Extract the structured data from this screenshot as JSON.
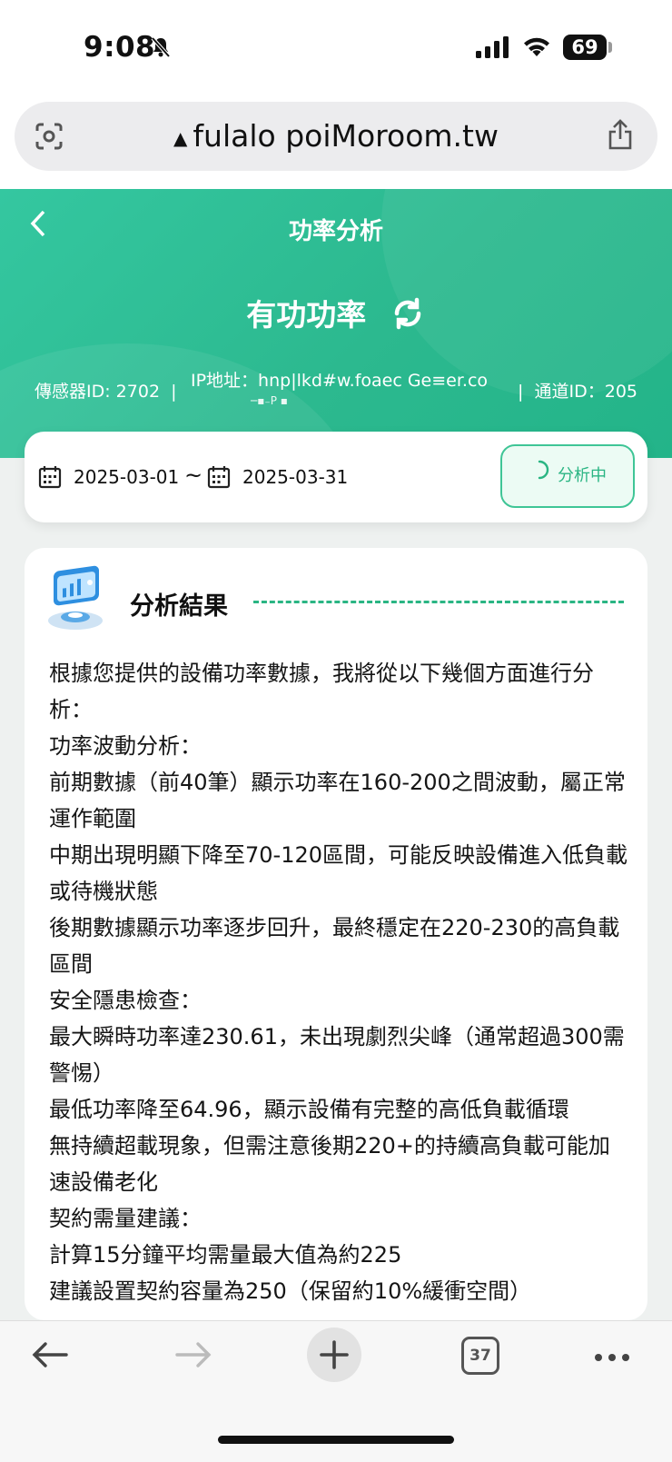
{
  "status_bar": {
    "time": "9:08",
    "battery": "69"
  },
  "url_bar": {
    "url": "fulalo poiMoroom.tw"
  },
  "header": {
    "title": "功率分析",
    "metric": "有功功率",
    "sensor": "傳感器ID: 2702",
    "ip": "IP地址：hnp|lkd#w.foaec  Ge≡er.co",
    "ip_sub": "─▪₋P ▪",
    "channel": "通道ID：205",
    "sep": "|"
  },
  "date_range": {
    "start": "2025-03-01",
    "separator": "~",
    "end": "2025-03-31",
    "button_label": "分析中"
  },
  "result": {
    "title": "分析結果",
    "lines": [
      "根據您提供的設備功率數據，我將從以下幾個方面進行分析：",
      "功率波動分析：",
      "前期數據（前40筆）顯示功率在160-200之間波動，屬正常運作範圍",
      "中期出現明顯下降至70-120區間，可能反映設備進入低負載或待機狀態",
      "後期數據顯示功率逐步回升，最終穩定在220-230的高負載區間",
      "安全隱患檢查：",
      "最大瞬時功率達230.61，未出現劇烈尖峰（通常超過300需警惕）",
      "最低功率降至64.96，顯示設備有完整的高低負載循環",
      "無持續超載現象，但需注意後期220+的持續高負載可能加速設備老化",
      "契約需量建議：",
      "計算15分鐘平均需量最大值為約225",
      "建議設置契約容量為250（保留約10%緩衝空間）"
    ]
  },
  "bottom_bar": {
    "tab_count": "37"
  },
  "colors": {
    "accent": "#2ab583",
    "header": "#2cb98f"
  },
  "icons": [
    "bell-slash-icon",
    "signal-icon",
    "wifi-icon",
    "battery-icon",
    "scan-icon",
    "warning-icon",
    "share-icon",
    "back-chevron-icon",
    "refresh-icon",
    "calendar-icon",
    "spinner-icon",
    "analysis-illustration-icon",
    "arrow-left-icon",
    "arrow-right-icon",
    "plus-icon",
    "tabs-icon",
    "more-icon"
  ]
}
